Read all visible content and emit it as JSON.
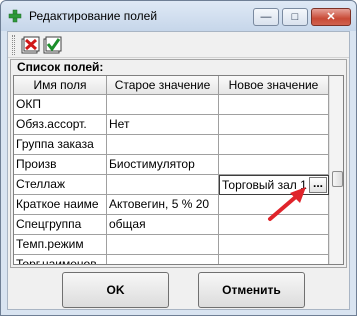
{
  "window": {
    "title": "Редактирование полей",
    "controls": {
      "minimize": "—",
      "maximize": "□",
      "close": "✕"
    }
  },
  "toolbar": {
    "icons": [
      "cancel-x-icon",
      "apply-check-icon"
    ]
  },
  "group": {
    "label": "Список полей:"
  },
  "grid": {
    "columns": [
      "Имя поля",
      "Старое значение",
      "Новое значение"
    ],
    "rows": [
      {
        "name": "ОКП",
        "old": "",
        "new": ""
      },
      {
        "name": "Обяз.ассорт.",
        "old": "Нет",
        "new": ""
      },
      {
        "name": "Группа заказа",
        "old": "",
        "new": ""
      },
      {
        "name": "Произв",
        "old": "Биостимулятор",
        "new": ""
      },
      {
        "name": "Стеллаж",
        "old": "",
        "new": "Торговый зал 1"
      },
      {
        "name": "Краткое наиме",
        "old": "Актовегин, 5 % 20",
        "new": ""
      },
      {
        "name": "Спецгруппа",
        "old": "общая",
        "new": ""
      },
      {
        "name": "Темп.режим",
        "old": "",
        "new": ""
      },
      {
        "name": "Торг.наименов",
        "old": "",
        "new": ""
      }
    ],
    "editor_button": "..."
  },
  "buttons": {
    "ok": "OK",
    "cancel": "Отменить"
  },
  "colors": {
    "title_bar": "#c6d6ea",
    "close_button": "#c84a36",
    "annotation_arrow": "#e0242b"
  }
}
